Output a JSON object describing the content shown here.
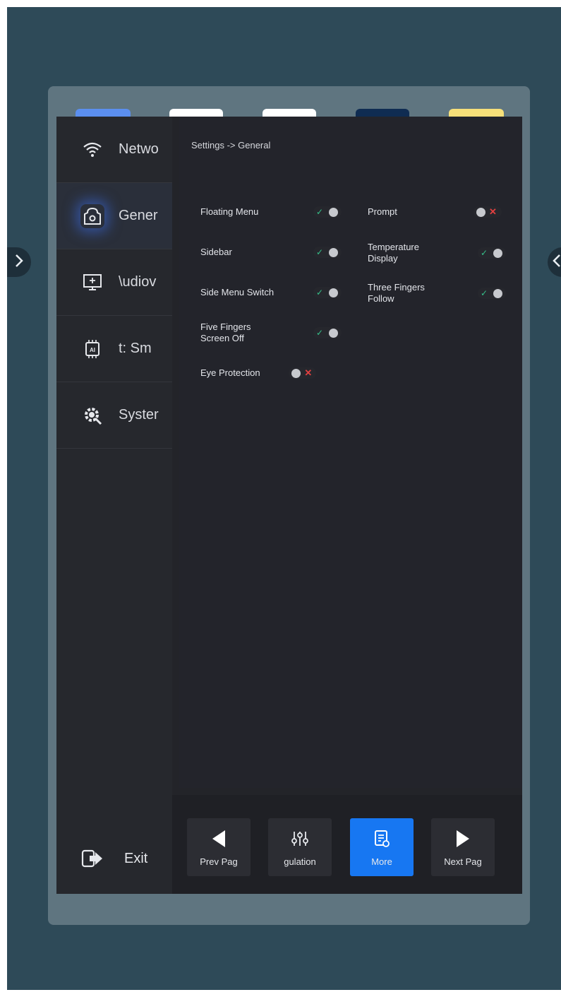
{
  "breadcrumb": "Settings -> General",
  "sidebar": {
    "items": [
      {
        "label": "Netwo",
        "icon": "wifi-icon"
      },
      {
        "label": "Gener",
        "icon": "general-settings-icon",
        "active": true
      },
      {
        "label": "\\udiov",
        "icon": "audiovisual-icon"
      },
      {
        "label": "t: Sm",
        "icon": "ai-chip-icon"
      },
      {
        "label": "Syster",
        "icon": "system-gear-icon"
      }
    ],
    "exit_label": "Exit"
  },
  "settings": {
    "left": [
      {
        "label": "Floating Menu",
        "state": "on"
      },
      {
        "label": "Sidebar",
        "state": "on"
      },
      {
        "label": "Side Menu Switch",
        "state": "on"
      },
      {
        "label": "Five Fingers Screen Off",
        "state": "on"
      },
      {
        "label": "Eye Protection",
        "state": "off"
      }
    ],
    "right": [
      {
        "label": "Prompt",
        "state": "off"
      },
      {
        "label": "Temperature Display",
        "state": "on"
      },
      {
        "label": "Three Fingers Follow",
        "state": "on"
      }
    ]
  },
  "bottombar": {
    "buttons": [
      {
        "label": "Prev Pag",
        "icon": "play-left-icon"
      },
      {
        "label": "gulation",
        "icon": "sliders-icon"
      },
      {
        "label": "More",
        "icon": "document-icon",
        "primary": true
      },
      {
        "label": "Next Pag",
        "icon": "play-right-icon"
      }
    ]
  },
  "colors": {
    "accent": "#1777f2",
    "on": "#35c08a",
    "off": "#e34040"
  }
}
